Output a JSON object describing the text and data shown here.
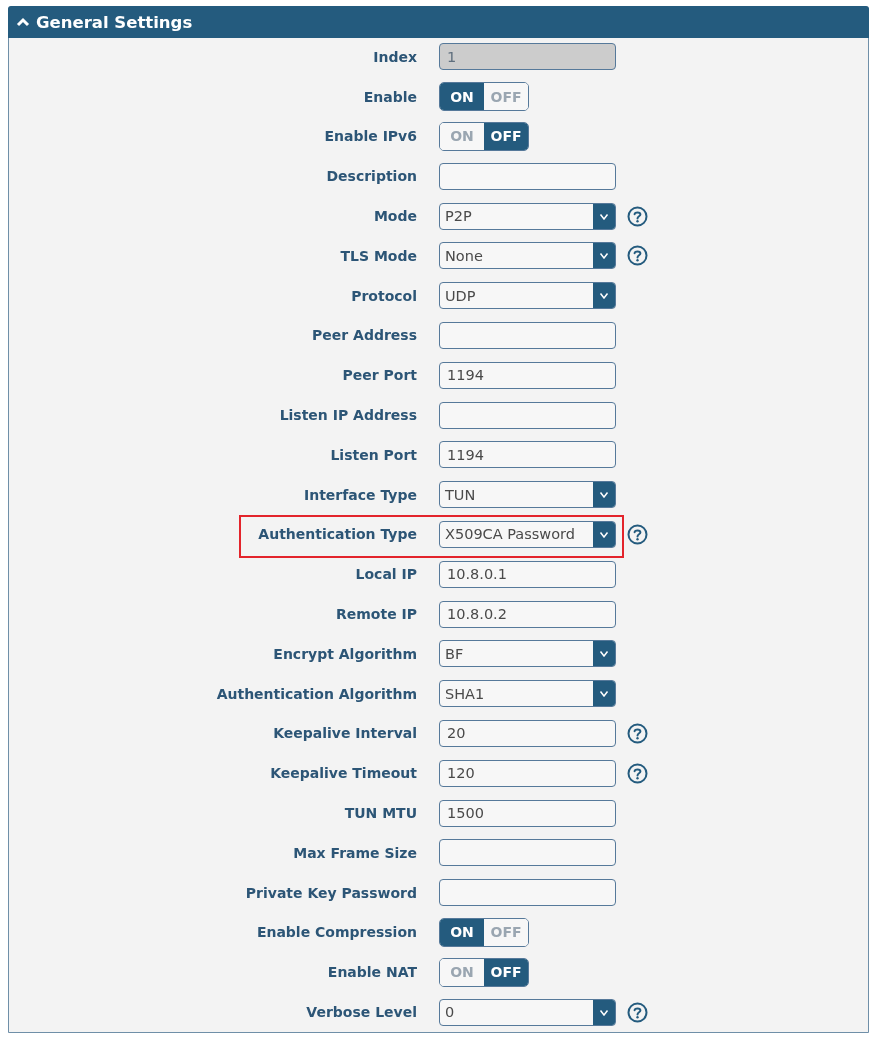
{
  "section": {
    "title": "General Settings",
    "expanded": true
  },
  "rows": [
    {
      "label": "Index",
      "kind": "text",
      "value": "1",
      "disabled": true,
      "help": false,
      "highlighted": false
    },
    {
      "label": "Enable",
      "kind": "toggle",
      "on": true,
      "on_label": "ON",
      "off_label": "OFF",
      "disabled": false,
      "help": false,
      "highlighted": false
    },
    {
      "label": "Enable IPv6",
      "kind": "toggle",
      "on": false,
      "on_label": "ON",
      "off_label": "OFF",
      "disabled": false,
      "help": false,
      "highlighted": false
    },
    {
      "label": "Description",
      "kind": "text",
      "disabled": false,
      "help": false,
      "highlighted": false
    },
    {
      "label": "Mode",
      "kind": "select",
      "value": "P2P",
      "disabled": false,
      "help": true,
      "highlighted": false
    },
    {
      "label": "TLS Mode",
      "kind": "select",
      "value": "None",
      "disabled": false,
      "help": true,
      "highlighted": false
    },
    {
      "label": "Protocol",
      "kind": "select",
      "value": "UDP",
      "disabled": false,
      "help": false,
      "highlighted": false
    },
    {
      "label": "Peer Address",
      "kind": "text",
      "disabled": false,
      "help": false,
      "highlighted": false
    },
    {
      "label": "Peer Port",
      "kind": "text",
      "value": "1194",
      "disabled": false,
      "help": false,
      "highlighted": false
    },
    {
      "label": "Listen IP Address",
      "kind": "text",
      "disabled": false,
      "help": false,
      "highlighted": false
    },
    {
      "label": "Listen Port",
      "kind": "text",
      "value": "1194",
      "disabled": false,
      "help": false,
      "highlighted": false
    },
    {
      "label": "Interface Type",
      "kind": "select",
      "value": "TUN",
      "disabled": false,
      "help": false,
      "highlighted": false
    },
    {
      "label": "Authentication Type",
      "kind": "select",
      "value": "X509CA Password",
      "disabled": false,
      "help": true,
      "highlighted": true
    },
    {
      "label": "Local IP",
      "kind": "text",
      "value": "10.8.0.1",
      "disabled": false,
      "help": false,
      "highlighted": false
    },
    {
      "label": "Remote IP",
      "kind": "text",
      "value": "10.8.0.2",
      "disabled": false,
      "help": false,
      "highlighted": false
    },
    {
      "label": "Encrypt Algorithm",
      "kind": "select",
      "value": "BF",
      "disabled": false,
      "help": false,
      "highlighted": false
    },
    {
      "label": "Authentication Algorithm",
      "kind": "select",
      "value": "SHA1",
      "disabled": false,
      "help": false,
      "highlighted": false
    },
    {
      "label": "Keepalive Interval",
      "kind": "text",
      "value": "20",
      "disabled": false,
      "help": true,
      "highlighted": false
    },
    {
      "label": "Keepalive Timeout",
      "kind": "text",
      "value": "120",
      "disabled": false,
      "help": true,
      "highlighted": false
    },
    {
      "label": "TUN MTU",
      "kind": "text",
      "value": "1500",
      "disabled": false,
      "help": false,
      "highlighted": false
    },
    {
      "label": "Max Frame Size",
      "kind": "text",
      "disabled": false,
      "help": false,
      "highlighted": false
    },
    {
      "label": "Private Key Password",
      "kind": "text",
      "disabled": false,
      "help": false,
      "highlighted": false
    },
    {
      "label": "Enable Compression",
      "kind": "toggle",
      "on": true,
      "on_label": "ON",
      "off_label": "OFF",
      "disabled": false,
      "help": false,
      "highlighted": false
    },
    {
      "label": "Enable NAT",
      "kind": "toggle",
      "on": false,
      "on_label": "ON",
      "off_label": "OFF",
      "disabled": false,
      "help": false,
      "highlighted": false
    },
    {
      "label": "Verbose Level",
      "kind": "select",
      "value": "0",
      "disabled": false,
      "help": true,
      "highlighted": false
    }
  ]
}
